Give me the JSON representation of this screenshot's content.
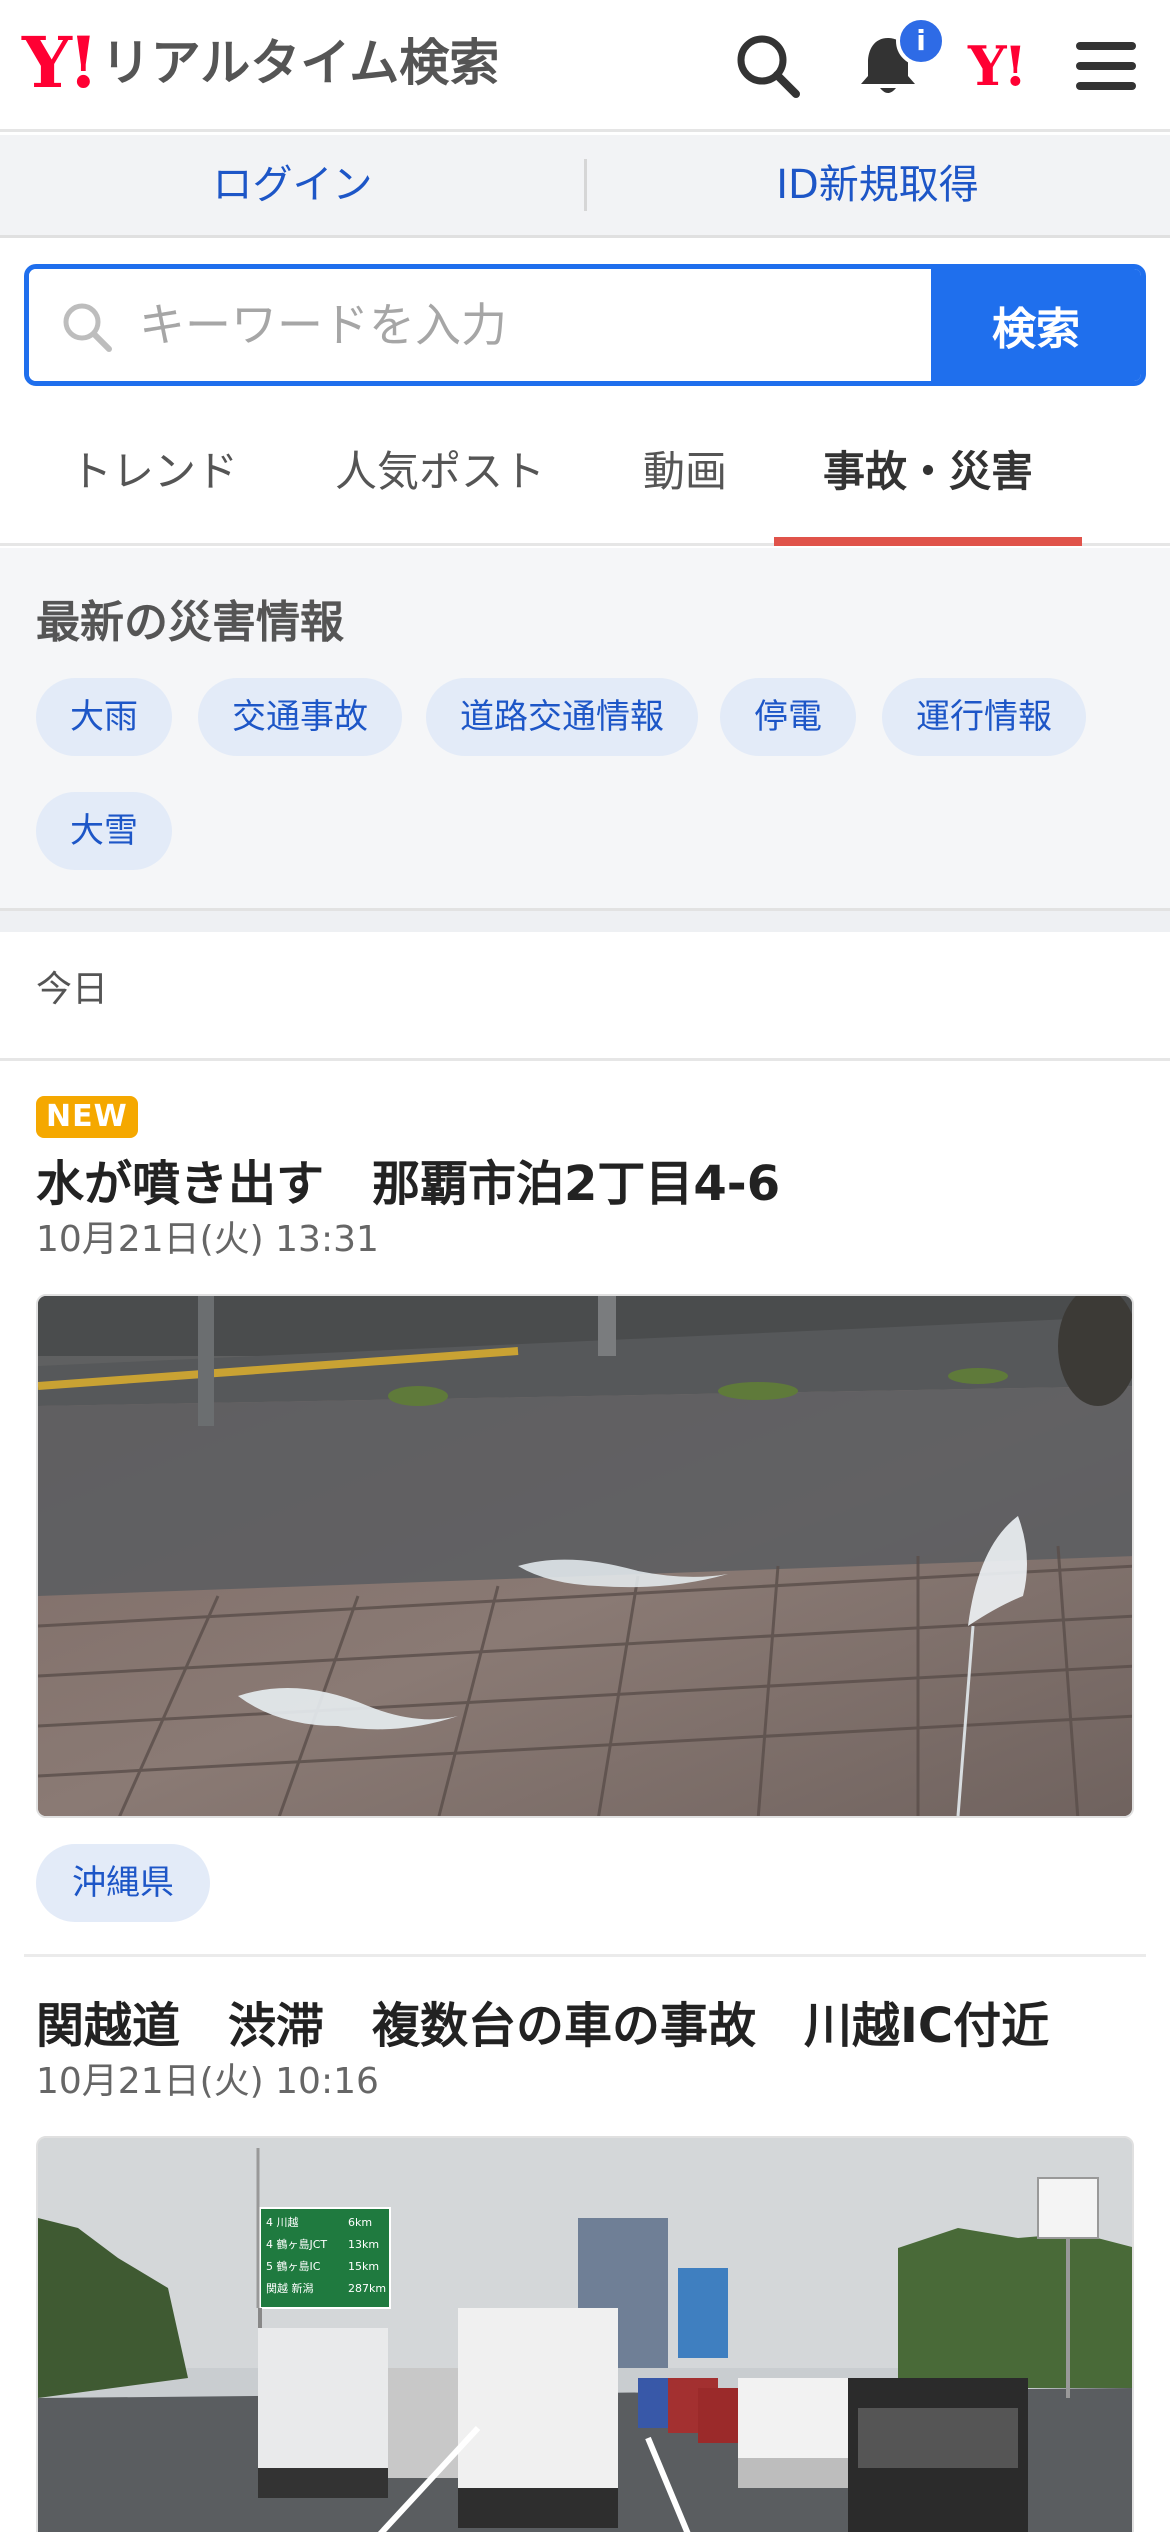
{
  "header": {
    "logo_mark": "Y!",
    "logo_text": "リアルタイム検索",
    "notification_badge": "i",
    "yahoo_icon_text": "Y!"
  },
  "account_bar": {
    "login": "ログイン",
    "signup": "ID新規取得"
  },
  "search": {
    "placeholder": "キーワードを入力",
    "value": "",
    "button": "検索"
  },
  "tabs": [
    {
      "label": "トレンド",
      "active": false
    },
    {
      "label": "人気ポスト",
      "active": false
    },
    {
      "label": "動画",
      "active": false
    },
    {
      "label": "事故・災害",
      "active": true
    }
  ],
  "disaster_info": {
    "title": "最新の災害情報",
    "chips": [
      "大雨",
      "交通事故",
      "道路交通情報",
      "停電",
      "運行情報",
      "大雪"
    ]
  },
  "section_label": "今日",
  "articles": [
    {
      "badge": "NEW",
      "title": "水が噴き出す　那覇市泊2丁目4-6",
      "date": "10月21日(火) 13:31",
      "location": "沖縄県"
    },
    {
      "title": "関越道　渋滞　複数台の車の事故　川越IC付近",
      "date": "10月21日(火) 10:16",
      "sign_lines": [
        "4 川越",
        "4 鶴ヶ島JCT",
        "5 鶴ヶ島IC",
        "関越 新潟"
      ],
      "sign_distances": [
        "6km",
        "13km",
        "15km",
        "287km"
      ]
    }
  ],
  "colors": {
    "brand_red": "#ff0033",
    "accent_blue": "#1f6fed",
    "link_blue": "#1d56c7",
    "active_tab_underline": "#e0534a",
    "new_badge": "#f5a800"
  }
}
